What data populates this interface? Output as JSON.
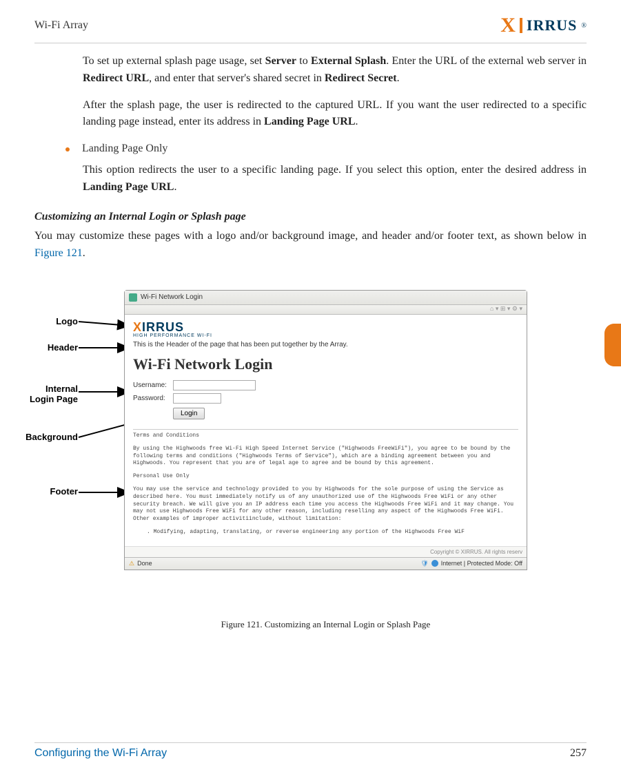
{
  "header": {
    "left": "Wi-Fi Array",
    "logo_text": "IRRUS",
    "logo_prefix": "X",
    "logo_r": "®"
  },
  "body": {
    "p1_a": "To set up external splash page usage, set ",
    "p1_b": "Server",
    "p1_c": " to ",
    "p1_d": "External Splash",
    "p1_e": ". Enter the URL of the external web server in ",
    "p1_f": "Redirect URL",
    "p1_g": ", and enter that server's shared secret in ",
    "p1_h": "Redirect Secret",
    "p1_i": ".",
    "p2_a": "After the splash page, the user is redirected to the captured URL. If you want the user redirected to a specific landing page instead, enter its address in ",
    "p2_b": "Landing Page URL",
    "p2_c": ".",
    "bullet": "Landing Page Only",
    "p3_a": "This option redirects the user to a specific landing page. If you select this option, enter the desired address in ",
    "p3_b": "Landing Page URL",
    "p3_c": ".",
    "subhead": "Customizing an Internal Login or Splash page",
    "p4_a": "You may customize these pages with a logo and/or background image, and header and/or footer text, as shown below in ",
    "p4_link": "Figure 121",
    "p4_b": "."
  },
  "callouts": {
    "logo": "Logo",
    "header": "Header",
    "internal1": "Internal",
    "internal2": "Login Page",
    "background": "Background",
    "footer": "Footer"
  },
  "screenshot": {
    "tab_title": "Wi-Fi Network Login",
    "toolbar_placeholder": "⌂ ▾  ⊞ ▾  ⚙ ▾",
    "logo_text": "IRRUS",
    "logo_prefix": "X",
    "logo_sub": "HIGH PERFORMANCE WI-FI",
    "header_text": "This is the Header of the page that has been put together by the Array.",
    "title": "Wi-Fi Network Login",
    "username_label": "Username:",
    "password_label": "Password:",
    "login_btn": "Login",
    "terms_title": "Terms and Conditions",
    "terms_p1": "By using the Highwoods free Wi-Fi High Speed Internet Service (\"Highwoods FreeWiFi\"), you agree to be bound by the following terms and conditions (\"Highwoods Terms of Service\"), which are a binding agreement between you and Highwoods. You represent that you are of legal age to agree and be bound by this agreement.",
    "terms_sub": "Personal Use Only",
    "terms_p2": "You may use the service and technology provided to you by Highwoods for the sole purpose of using the Service as described here. You must immediately notify us of any unauthorized use of the Highwoods Free WiFi or any other security breach. We will give you an IP address each time you access the Highwoods Free WiFi and it may change. You may not use Highwoods Free WiFi for any other reason, including reselling any aspect of the Highwoods Free WiFi. Other examples of improper activitiinclude, without limitation:",
    "terms_item": ". Modifying, adapting, translating, or reverse engineering any portion of the Highwoods Free WiF",
    "copyright": "Copyright © XIRRUS. All rights reserv",
    "status_left": "Done",
    "status_right": "Internet | Protected Mode: Off"
  },
  "caption": "Figure 121. Customizing an Internal Login or Splash Page",
  "footer": {
    "left": "Configuring the Wi-Fi Array",
    "right": "257"
  }
}
